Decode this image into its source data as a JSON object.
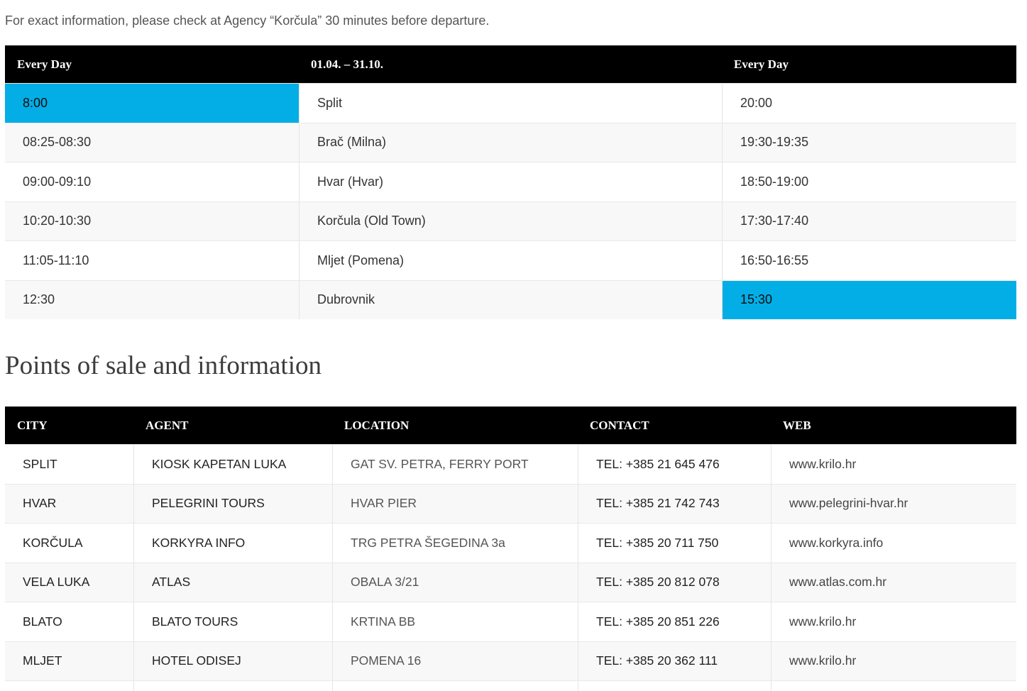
{
  "notice": "For exact information, please check at Agency “Korčula” 30 minutes before departure.",
  "colors": {
    "highlight": "#03aee6",
    "header_background": "#000000",
    "stripe": "#f8f8f8"
  },
  "timetable": {
    "headers": {
      "departure": "Every Day",
      "period": "01.04. – 31.10.",
      "return": "Every Day"
    },
    "rows": [
      {
        "departure": "8:00",
        "port": "Split",
        "return": "20:00"
      },
      {
        "departure": "08:25-08:30",
        "port": "Brač (Milna)",
        "return": "19:30-19:35"
      },
      {
        "departure": "09:00-09:10",
        "port": "Hvar (Hvar)",
        "return": "18:50-19:00"
      },
      {
        "departure": "10:20-10:30",
        "port": "Korčula (Old Town)",
        "return": "17:30-17:40"
      },
      {
        "departure": "11:05-11:10",
        "port": "Mljet (Pomena)",
        "return": "16:50-16:55"
      },
      {
        "departure": "12:30",
        "port": "Dubrovnik",
        "return": "15:30"
      }
    ]
  },
  "points_of_sale": {
    "title": "Points of sale and information",
    "headers": {
      "city": "CITY",
      "agent": "AGENT",
      "location": "LOCATION",
      "contact": "CONTACT",
      "web": "WEB"
    },
    "rows": [
      {
        "city": "SPLIT",
        "agent": "KIOSK KAPETAN LUKA",
        "location": "GAT SV. PETRA, FERRY PORT",
        "contact": "TEL: +385 21 645 476",
        "web": "www.krilo.hr"
      },
      {
        "city": "HVAR",
        "agent": "PELEGRINI TOURS",
        "location": "HVAR PIER",
        "contact": "TEL: +385 21 742 743",
        "web": "www.pelegrini-hvar.hr"
      },
      {
        "city": "KORČULA",
        "agent": "KORKYRA INFO",
        "location": "TRG PETRA ŠEGEDINA 3a",
        "contact": "TEL: +385 20 711 750",
        "web": "www.korkyra.info"
      },
      {
        "city": "VELA LUKA",
        "agent": "ATLAS",
        "location": "OBALA 3/21",
        "contact": "TEL: +385 20 812 078",
        "web": "www.atlas.com.hr"
      },
      {
        "city": "BLATO",
        "agent": "BLATO TOURS",
        "location": "KRTINA BB",
        "contact": "TEL: +385 20 851 226",
        "web": "www.krilo.hr"
      },
      {
        "city": "MLJET",
        "agent": "HOTEL ODISEJ",
        "location": "POMENA 16",
        "contact": "TEL: +385 20 362 111",
        "web": "www.krilo.hr"
      }
    ]
  }
}
